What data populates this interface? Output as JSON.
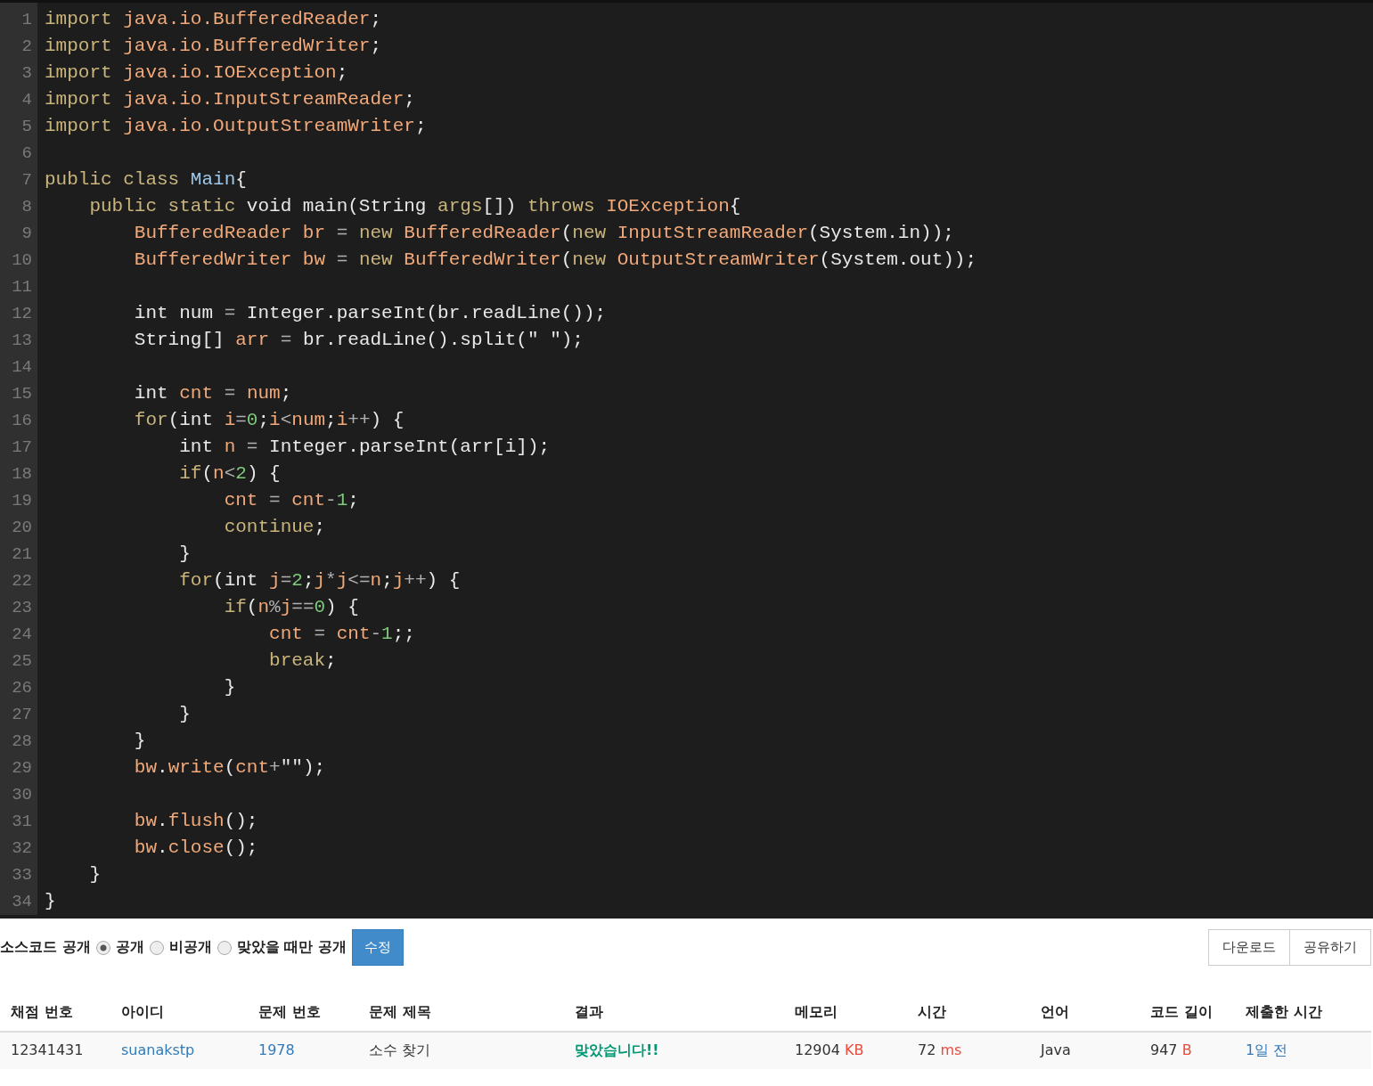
{
  "code_editor": {
    "lines": [
      {
        "number": "1",
        "tokens": [
          {
            "kind": "k",
            "text": "import "
          },
          {
            "kind": "i",
            "text": "java.io.BufferedReader"
          },
          {
            "kind": "p",
            "text": ";"
          }
        ]
      },
      {
        "number": "2",
        "tokens": [
          {
            "kind": "k",
            "text": "import "
          },
          {
            "kind": "i",
            "text": "java.io.BufferedWriter"
          },
          {
            "kind": "p",
            "text": ";"
          }
        ]
      },
      {
        "number": "3",
        "tokens": [
          {
            "kind": "k",
            "text": "import "
          },
          {
            "kind": "i",
            "text": "java.io.IOException"
          },
          {
            "kind": "p",
            "text": ";"
          }
        ]
      },
      {
        "number": "4",
        "tokens": [
          {
            "kind": "k",
            "text": "import "
          },
          {
            "kind": "i",
            "text": "java.io.InputStreamReader"
          },
          {
            "kind": "p",
            "text": ";"
          }
        ]
      },
      {
        "number": "5",
        "tokens": [
          {
            "kind": "k",
            "text": "import "
          },
          {
            "kind": "i",
            "text": "java.io.OutputStreamWriter"
          },
          {
            "kind": "p",
            "text": ";"
          }
        ]
      },
      {
        "number": "6"
      },
      {
        "number": "7",
        "tokens": [
          {
            "kind": "k",
            "text": "public class "
          },
          {
            "kind": "t",
            "text": "Main"
          },
          {
            "kind": "p",
            "text": "{"
          }
        ]
      },
      {
        "number": "8",
        "tokens": [
          {
            "kind": "k",
            "text": "    public static "
          },
          {
            "kind": "p",
            "text": "void main(String "
          },
          {
            "kind": "k",
            "text": "args"
          },
          {
            "kind": "p",
            "text": "[]) "
          },
          {
            "kind": "k",
            "text": "throws "
          },
          {
            "kind": "i",
            "text": "IOException"
          },
          {
            "kind": "p",
            "text": "{"
          }
        ]
      },
      {
        "number": "9",
        "tokens": [
          {
            "kind": "i",
            "text": "        BufferedReader br "
          },
          {
            "kind": "o",
            "text": "= "
          },
          {
            "kind": "k",
            "text": "new "
          },
          {
            "kind": "i",
            "text": "BufferedReader"
          },
          {
            "kind": "p",
            "text": "("
          },
          {
            "kind": "k",
            "text": "new "
          },
          {
            "kind": "i",
            "text": "InputStreamReader"
          },
          {
            "kind": "p",
            "text": "(System.in));"
          }
        ]
      },
      {
        "number": "10",
        "tokens": [
          {
            "kind": "i",
            "text": "        BufferedWriter bw "
          },
          {
            "kind": "o",
            "text": "= "
          },
          {
            "kind": "k",
            "text": "new "
          },
          {
            "kind": "i",
            "text": "BufferedWriter"
          },
          {
            "kind": "p",
            "text": "("
          },
          {
            "kind": "k",
            "text": "new "
          },
          {
            "kind": "i",
            "text": "OutputStreamWriter"
          },
          {
            "kind": "p",
            "text": "(System.out));"
          }
        ]
      },
      {
        "number": "11"
      },
      {
        "number": "12",
        "tokens": [
          {
            "kind": "p",
            "text": "        int num "
          },
          {
            "kind": "o",
            "text": "= "
          },
          {
            "kind": "p",
            "text": "Integer.parseInt(br.readLine());"
          }
        ]
      },
      {
        "number": "13",
        "tokens": [
          {
            "kind": "p",
            "text": "        String[] "
          },
          {
            "kind": "i",
            "text": "arr "
          },
          {
            "kind": "o",
            "text": "= "
          },
          {
            "kind": "p",
            "text": "br.readLine().split(\" \");"
          }
        ]
      },
      {
        "number": "14"
      },
      {
        "number": "15",
        "tokens": [
          {
            "kind": "p",
            "text": "        int "
          },
          {
            "kind": "i",
            "text": "cnt "
          },
          {
            "kind": "o",
            "text": "= "
          },
          {
            "kind": "i",
            "text": "num"
          },
          {
            "kind": "p",
            "text": ";"
          }
        ]
      },
      {
        "number": "16",
        "tokens": [
          {
            "kind": "k",
            "text": "        for"
          },
          {
            "kind": "p",
            "text": "(int "
          },
          {
            "kind": "i",
            "text": "i"
          },
          {
            "kind": "o",
            "text": "="
          },
          {
            "kind": "n",
            "text": "0"
          },
          {
            "kind": "p",
            "text": ";"
          },
          {
            "kind": "i",
            "text": "i"
          },
          {
            "kind": "o",
            "text": "<"
          },
          {
            "kind": "i",
            "text": "num"
          },
          {
            "kind": "p",
            "text": ";"
          },
          {
            "kind": "i",
            "text": "i"
          },
          {
            "kind": "o",
            "text": "++"
          },
          {
            "kind": "p",
            "text": ") {"
          }
        ]
      },
      {
        "number": "17",
        "tokens": [
          {
            "kind": "p",
            "text": "            int "
          },
          {
            "kind": "i",
            "text": "n "
          },
          {
            "kind": "o",
            "text": "= "
          },
          {
            "kind": "p",
            "text": "Integer.parseInt(arr[i]);"
          }
        ]
      },
      {
        "number": "18",
        "tokens": [
          {
            "kind": "k",
            "text": "            if"
          },
          {
            "kind": "p",
            "text": "("
          },
          {
            "kind": "i",
            "text": "n"
          },
          {
            "kind": "o",
            "text": "<"
          },
          {
            "kind": "n",
            "text": "2"
          },
          {
            "kind": "p",
            "text": ") {"
          }
        ]
      },
      {
        "number": "19",
        "tokens": [
          {
            "kind": "i",
            "text": "                cnt "
          },
          {
            "kind": "o",
            "text": "= "
          },
          {
            "kind": "i",
            "text": "cnt"
          },
          {
            "kind": "o",
            "text": "-"
          },
          {
            "kind": "n",
            "text": "1"
          },
          {
            "kind": "p",
            "text": ";"
          }
        ]
      },
      {
        "number": "20",
        "tokens": [
          {
            "kind": "k",
            "text": "                continue"
          },
          {
            "kind": "p",
            "text": ";"
          }
        ]
      },
      {
        "number": "21",
        "tokens": [
          {
            "kind": "p",
            "text": "            }"
          }
        ]
      },
      {
        "number": "22",
        "tokens": [
          {
            "kind": "k",
            "text": "            for"
          },
          {
            "kind": "p",
            "text": "(int "
          },
          {
            "kind": "i",
            "text": "j"
          },
          {
            "kind": "o",
            "text": "="
          },
          {
            "kind": "n",
            "text": "2"
          },
          {
            "kind": "p",
            "text": ";"
          },
          {
            "kind": "i",
            "text": "j"
          },
          {
            "kind": "o",
            "text": "*"
          },
          {
            "kind": "i",
            "text": "j"
          },
          {
            "kind": "o",
            "text": "<="
          },
          {
            "kind": "i",
            "text": "n"
          },
          {
            "kind": "p",
            "text": ";"
          },
          {
            "kind": "i",
            "text": "j"
          },
          {
            "kind": "o",
            "text": "++"
          },
          {
            "kind": "p",
            "text": ") {"
          }
        ]
      },
      {
        "number": "23",
        "tokens": [
          {
            "kind": "k",
            "text": "                if"
          },
          {
            "kind": "p",
            "text": "("
          },
          {
            "kind": "i",
            "text": "n"
          },
          {
            "kind": "o",
            "text": "%"
          },
          {
            "kind": "i",
            "text": "j"
          },
          {
            "kind": "o",
            "text": "=="
          },
          {
            "kind": "n",
            "text": "0"
          },
          {
            "kind": "p",
            "text": ") {"
          }
        ]
      },
      {
        "number": "24",
        "tokens": [
          {
            "kind": "i",
            "text": "                    cnt "
          },
          {
            "kind": "o",
            "text": "= "
          },
          {
            "kind": "i",
            "text": "cnt"
          },
          {
            "kind": "o",
            "text": "-"
          },
          {
            "kind": "n",
            "text": "1"
          },
          {
            "kind": "p",
            "text": ";;"
          }
        ]
      },
      {
        "number": "25",
        "tokens": [
          {
            "kind": "k",
            "text": "                    break"
          },
          {
            "kind": "p",
            "text": ";"
          }
        ]
      },
      {
        "number": "26",
        "tokens": [
          {
            "kind": "p",
            "text": "                }"
          }
        ]
      },
      {
        "number": "27",
        "tokens": [
          {
            "kind": "p",
            "text": "            }"
          }
        ]
      },
      {
        "number": "28",
        "tokens": [
          {
            "kind": "p",
            "text": "        }"
          }
        ]
      },
      {
        "number": "29",
        "tokens": [
          {
            "kind": "i",
            "text": "        bw"
          },
          {
            "kind": "p",
            "text": "."
          },
          {
            "kind": "i",
            "text": "write"
          },
          {
            "kind": "p",
            "text": "("
          },
          {
            "kind": "i",
            "text": "cnt"
          },
          {
            "kind": "o",
            "text": "+"
          },
          {
            "kind": "p",
            "text": "\"\");"
          }
        ]
      },
      {
        "number": "30"
      },
      {
        "number": "31",
        "tokens": [
          {
            "kind": "i",
            "text": "        bw"
          },
          {
            "kind": "p",
            "text": "."
          },
          {
            "kind": "i",
            "text": "flush"
          },
          {
            "kind": "p",
            "text": "();"
          }
        ]
      },
      {
        "number": "32",
        "tokens": [
          {
            "kind": "i",
            "text": "        bw"
          },
          {
            "kind": "p",
            "text": "."
          },
          {
            "kind": "i",
            "text": "close"
          },
          {
            "kind": "p",
            "text": "();"
          }
        ]
      },
      {
        "number": "33",
        "tokens": [
          {
            "kind": "p",
            "text": "    }"
          }
        ]
      },
      {
        "number": "34",
        "tokens": [
          {
            "kind": "p",
            "text": "}"
          }
        ]
      }
    ]
  },
  "visibility": {
    "label": "소스코드 공개",
    "options": [
      {
        "label": "공개",
        "selected": true
      },
      {
        "label": "비공개",
        "selected": false
      },
      {
        "label": "맞았을 때만 공개",
        "selected": false
      }
    ],
    "save_button": "수정"
  },
  "actions": [
    "다운로드",
    "공유하기"
  ],
  "table": {
    "columns": [
      "채점 번호",
      "아이디",
      "문제 번호",
      "문제 제목",
      "결과",
      "메모리",
      "시간",
      "언어",
      "코드 길이",
      "제출한 시간"
    ],
    "rows": [
      {
        "cells": [
          {
            "kind": "plain",
            "text": "12341431"
          },
          {
            "kind": "link",
            "text": "suanakstp"
          },
          {
            "kind": "link",
            "text": "1978"
          },
          {
            "kind": "plain",
            "text": "소수 찾기"
          },
          {
            "kind": "result",
            "text": "맞았습니다!!"
          },
          {
            "kind": "unit",
            "text": "12904",
            "unit": "KB"
          },
          {
            "kind": "unit",
            "text": "72",
            "unit": "ms"
          },
          {
            "kind": "plain",
            "text": "Java"
          },
          {
            "kind": "unit",
            "text": "947",
            "unit": "B"
          },
          {
            "kind": "link",
            "text": "1일 전"
          }
        ]
      }
    ]
  }
}
